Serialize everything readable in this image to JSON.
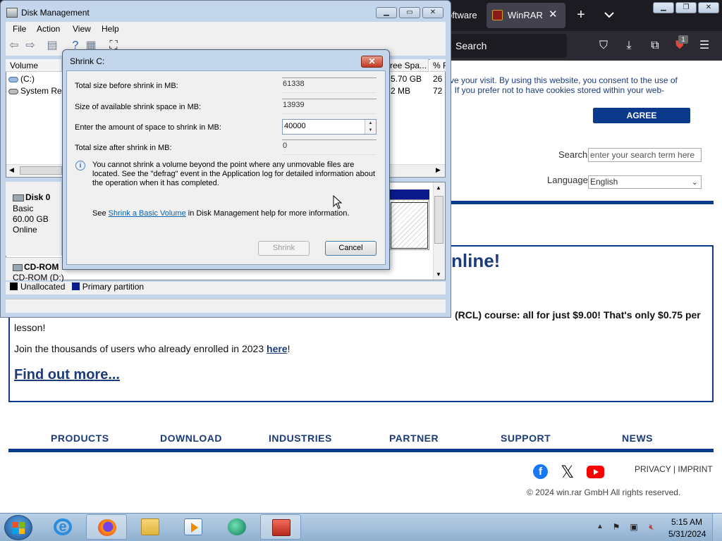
{
  "browser": {
    "prev_tab_text": "oftware",
    "active_tab_title": "WinRAR d",
    "tab_close": "✕",
    "new_tab": "+",
    "search_placeholder": "Search",
    "badge": "1"
  },
  "website": {
    "cookie_text": "ve your visit. By using this website, you consent to the use of\n. If you prefer not to have cookies stored within your web-",
    "agree_label": "AGREE",
    "search_label": "Search",
    "search_placeholder": "enter your search term here",
    "language_label": "Language",
    "language_value": "English",
    "promo_heading": "nline!",
    "promo_line1": "(RCL) course: all for just $9.00! That's only $0.75 per",
    "promo_line1b": "lesson!",
    "promo_line2_pre": "Join the thousands of users who already enrolled in 2023 ",
    "promo_line2_link": "here",
    "promo_line2_post": "!",
    "find_more": "Find out more...",
    "nav": [
      "PRODUCTS",
      "DOWNLOAD",
      "INDUSTRIES",
      "PARTNER",
      "SUPPORT",
      "NEWS"
    ],
    "legal_privacy": "PRIVACY",
    "legal_sep": " | ",
    "legal_imprint": "IMPRINT",
    "copyright": "© 2024 win.rar GmbH All rights reserved."
  },
  "disk_mgmt": {
    "title": "Disk Management",
    "menu": [
      "File",
      "Action",
      "View",
      "Help"
    ],
    "columns": {
      "volume": "Volume",
      "free_space": "ree Spa...",
      "pct": "% F"
    },
    "rows": [
      {
        "volume": "(C:)",
        "free": "5.70 GB",
        "pct": "26"
      },
      {
        "volume": "System Res",
        "free": "2 MB",
        "pct": "72"
      }
    ],
    "disk0": {
      "name": "Disk 0",
      "type": "Basic",
      "size": "60.00 GB",
      "status": "Online"
    },
    "cdrom": {
      "name": "CD-ROM",
      "drive": "CD-ROM (D:)"
    },
    "legend": {
      "unallocated": "Unallocated",
      "primary": "Primary partition"
    },
    "legend_colors": {
      "unallocated": "#000000",
      "primary": "#0a1a8c"
    }
  },
  "shrink_dialog": {
    "title": "Shrink C:",
    "close": "✕",
    "fields": {
      "total_before_label": "Total size before shrink in MB:",
      "total_before_value": "61338",
      "available_label": "Size of available shrink space in MB:",
      "available_value": "13939",
      "amount_label": "Enter the amount of space to shrink in MB:",
      "amount_value": "40000",
      "total_after_label": "Total size after shrink in MB:",
      "total_after_value": "0"
    },
    "info_text": "You cannot shrink a volume beyond the point where any unmovable files are located. See the \"defrag\" event in the Application log for detailed information about the operation when it has completed.",
    "see_pre": "See ",
    "see_link": "Shrink a Basic Volume",
    "see_post": " in Disk Management help for more information.",
    "shrink_button": "Shrink",
    "cancel_button": "Cancel"
  },
  "taskbar": {
    "clock_time": "5:15 AM",
    "clock_date": "5/31/2024"
  }
}
